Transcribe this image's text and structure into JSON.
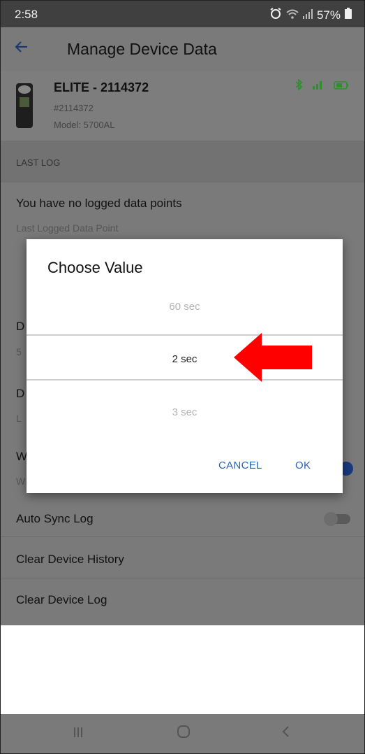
{
  "status_bar": {
    "time": "2:58",
    "battery": "57%",
    "icons": [
      "alarm-icon",
      "wifi-icon",
      "signal-icon",
      "battery-icon"
    ]
  },
  "app_bar": {
    "title": "Manage Device Data",
    "back_icon": "back-arrow-icon"
  },
  "device": {
    "name": "ELITE - 2114372",
    "serial": "#2114372",
    "model": "Model: 5700AL",
    "status_icons": [
      "bluetooth-icon",
      "signal-bars-icon",
      "battery-icon"
    ]
  },
  "section": {
    "last_log_label": "LAST LOG"
  },
  "last_log": {
    "message": "You have no logged data points",
    "subtitle": "Last Logged Data Point"
  },
  "background_rows": {
    "row1_initial": "D",
    "row1_sub": "5",
    "row2_initial": "D",
    "row2_sub": "L",
    "row3_initial": "W",
    "row3_sub": "W"
  },
  "settings": {
    "auto_sync_label": "Auto Sync Log",
    "auto_sync_on": false,
    "clear_history_label": "Clear Device History",
    "clear_log_label": "Clear Device Log"
  },
  "dialog": {
    "title": "Choose Value",
    "options": [
      "60 sec",
      "2 sec",
      "3 sec"
    ],
    "selected": "2 sec",
    "cancel_label": "CANCEL",
    "ok_label": "OK"
  },
  "annotation": {
    "arrow_color": "#ff0000",
    "points_to": "2 sec"
  },
  "colors": {
    "accent": "#2a62b8",
    "scrim": "#7a7a7a"
  }
}
